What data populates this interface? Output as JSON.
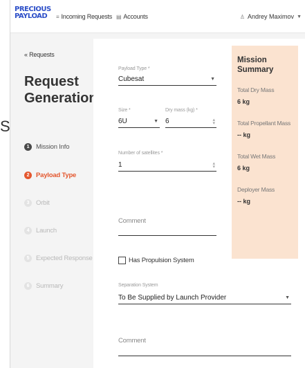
{
  "app": {
    "logo_line1": "PRECIOUS",
    "logo_line2": "PAYLOAD"
  },
  "nav": {
    "incoming_requests": "Incoming Requests",
    "accounts": "Accounts",
    "user_name": "Andrey Maximov"
  },
  "sidebar": {
    "back_link": "« Requests",
    "title": "Request Generation",
    "steps": [
      {
        "number": "1",
        "label": "Mission Info",
        "state": "done"
      },
      {
        "number": "2",
        "label": "Payload Type",
        "state": "active"
      },
      {
        "number": "3",
        "label": "Orbit",
        "state": "pending"
      },
      {
        "number": "4",
        "label": "Launch",
        "state": "pending"
      },
      {
        "number": "5",
        "label": "Expected Response",
        "state": "pending"
      },
      {
        "number": "6",
        "label": "Summary",
        "state": "pending"
      }
    ]
  },
  "form": {
    "payload_type_label": "Payload Type *",
    "payload_type_value": "Cubesat",
    "size_label": "Size *",
    "size_value": "6U",
    "dry_mass_label": "Dry mass (kg) *",
    "dry_mass_value": "6",
    "num_satellites_label": "Number of satellites *",
    "num_satellites_value": "1",
    "comment1_label": "Comment",
    "propulsion_label": "Has Propulsion System",
    "separation_label": "Separation System",
    "separation_value": "To Be Supplied by Launch Provider",
    "comment2_label": "Comment"
  },
  "summary": {
    "title": "Mission Summary",
    "items": [
      {
        "label": "Total Dry Mass",
        "value": "6 kg"
      },
      {
        "label": "Total Propellant Mass",
        "value": "-- kg"
      },
      {
        "label": "Total Wet Mass",
        "value": "6 kg"
      },
      {
        "label": "Deployer Mass",
        "value": "-- kg"
      }
    ]
  },
  "edge_text": "S",
  "colors": {
    "accent": "#e4572e",
    "brand": "#2d4fc8",
    "summary_bg": "#fbe3d0"
  }
}
